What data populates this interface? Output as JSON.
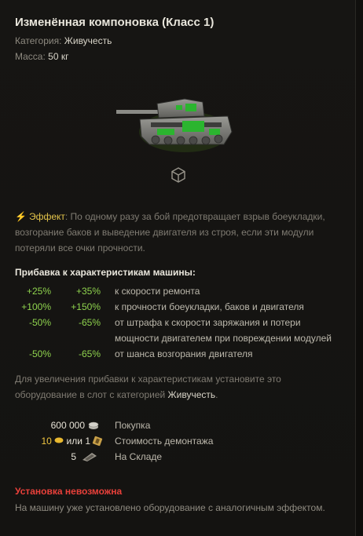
{
  "title": "Изменённая компоновка (Класс 1)",
  "category": {
    "label": "Категория:",
    "value": "Живучесть"
  },
  "mass": {
    "label": "Масса:",
    "value": "50 кг"
  },
  "effect": {
    "label": "Эффект",
    "text": ": По одному разу за бой предотвращает взрыв боеукладки, возгорание баков и выведение двигателя из строя, если эти модули потеряли все очки прочности."
  },
  "bonus_section_title": "Прибавка к характеристикам машины:",
  "bonuses": [
    {
      "v1": "+25%",
      "v2": "+35%",
      "desc": "к скорости ремонта"
    },
    {
      "v1": "+100%",
      "v2": "+150%",
      "desc": "к прочности боеукладки, баков и двигателя"
    },
    {
      "v1": "-50%",
      "v2": "-65%",
      "desc": "от штрафа к скорости заряжания и потери мощности двигателем при повреждении модулей"
    },
    {
      "v1": "-50%",
      "v2": "-65%",
      "desc": "от шанса возгорания двигателя"
    }
  ],
  "hint": {
    "prefix": "Для увеличения прибавки к характеристикам установите это оборудование в слот с категорией ",
    "highlight": "Живучесть",
    "suffix": "."
  },
  "prices": {
    "purchase": {
      "value": "600 000",
      "label": "Покупка",
      "icon": "credits-icon"
    },
    "demount": {
      "gold": "10",
      "or": "или",
      "alt": "1",
      "label": "Стоимость демонтажа",
      "icons": [
        "gold-icon",
        "demount-kit-icon"
      ]
    },
    "stock": {
      "value": "5",
      "label": "На Складе",
      "icon": "equipment-stock-icon"
    }
  },
  "warning": {
    "title": "Установка невозможна",
    "desc": "На машину уже установлено оборудование с аналогичным эффектом."
  },
  "colors": {
    "bonus_green": "#8fd34e",
    "warning_red": "#e9403a",
    "effect_yellow": "#e2c34a",
    "gold": "#f0c640"
  }
}
